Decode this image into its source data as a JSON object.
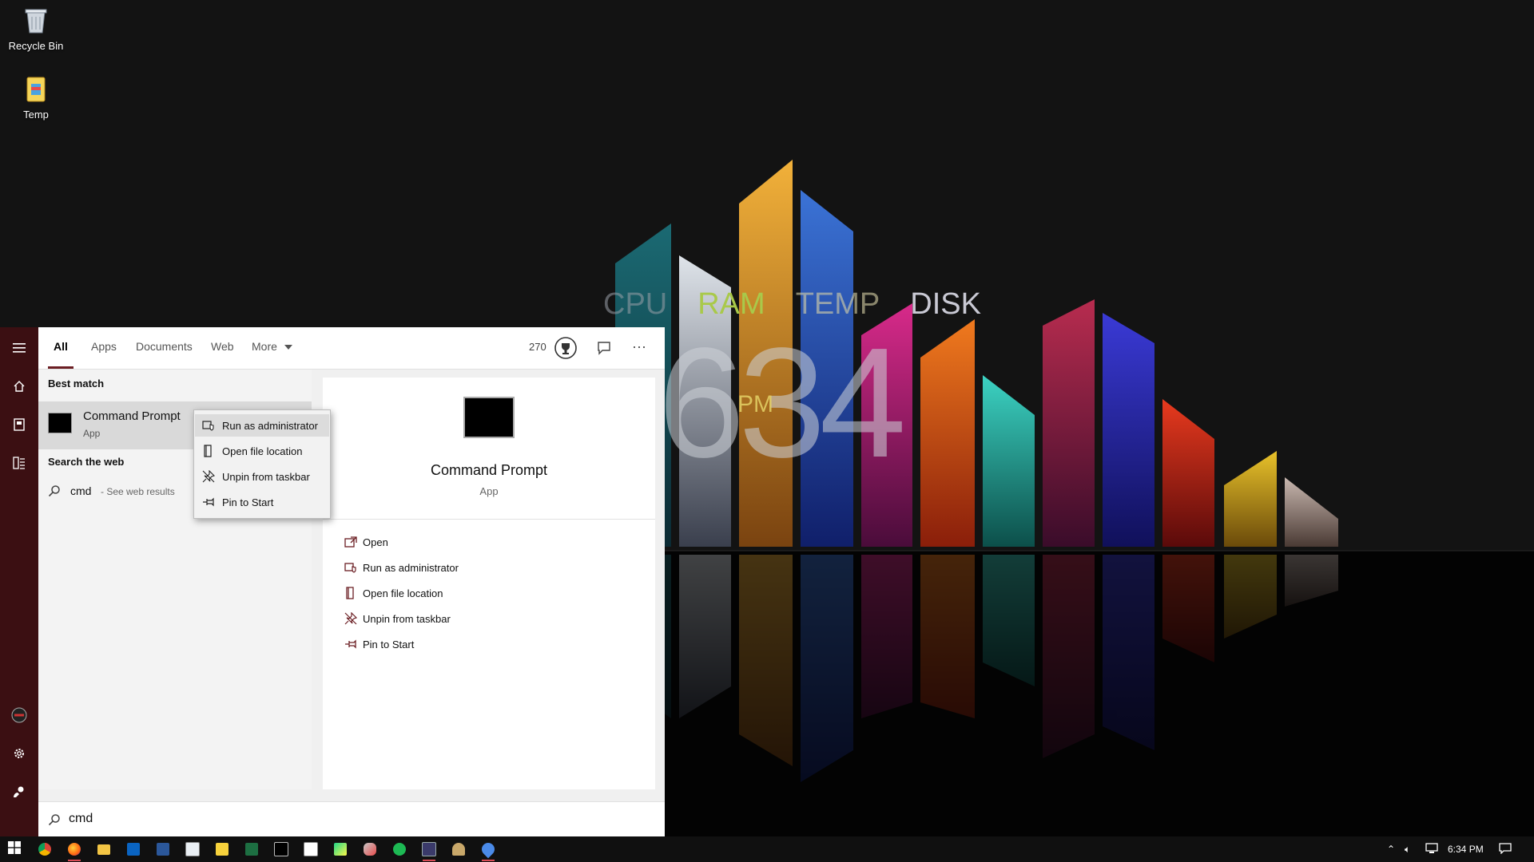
{
  "desktop": {
    "icons": [
      {
        "label": "Recycle Bin",
        "icon": "recycle-bin-icon"
      },
      {
        "label": "Temp",
        "icon": "folder-icon"
      }
    ],
    "widget": {
      "meters": [
        "CPU",
        "RAM",
        "TEMP",
        "DISK"
      ],
      "time_digits": "634",
      "meridiem": "PM",
      "colors": {
        "cpu": "#9aa0a8",
        "ram": "#a9c94a",
        "temp": "#d9d3a8",
        "disk": "#c9c9d4",
        "hour": "#e86d7f",
        "minute_tens": "#9ad84a",
        "minute_ones": "#cfd3d9"
      }
    }
  },
  "start_menu": {
    "rail": [
      "hamburger-menu-icon",
      "home-icon",
      "documents-icon",
      "apps-list-icon",
      "user-avatar-icon",
      "gear-icon",
      "feedback-icon"
    ],
    "tabs": [
      {
        "label": "All",
        "active": true
      },
      {
        "label": "Apps",
        "active": false
      },
      {
        "label": "Documents",
        "active": false
      },
      {
        "label": "Web",
        "active": false
      },
      {
        "label": "More",
        "active": false
      }
    ],
    "rewards_points": "270",
    "best_match_label": "Best match",
    "best_match": {
      "name": "Command Prompt",
      "type": "App"
    },
    "search_web_label": "Search the web",
    "web_result": {
      "query": "cmd",
      "suffix": "- See web results"
    },
    "context_menu": [
      "Run as administrator",
      "Open file location",
      "Unpin from taskbar",
      "Pin to Start"
    ],
    "preview": {
      "name": "Command Prompt",
      "type": "App",
      "actions": [
        "Open",
        "Run as administrator",
        "Open file location",
        "Unpin from taskbar",
        "Pin to Start"
      ]
    },
    "search_value": "cmd",
    "accent_color": "#6b1e23"
  },
  "taskbar": {
    "apps": [
      "chrome-icon",
      "firefox-icon",
      "file-explorer-icon",
      "outlook-icon",
      "word-icon",
      "notepad-icon",
      "sticky-notes-icon",
      "spreadsheet-icon",
      "command-prompt-icon",
      "notes-icon",
      "pycharm-icon",
      "game-icon",
      "spotify-icon",
      "app-window-icon",
      "person-icon",
      "maps-icon"
    ],
    "clock": "6:34 PM"
  }
}
